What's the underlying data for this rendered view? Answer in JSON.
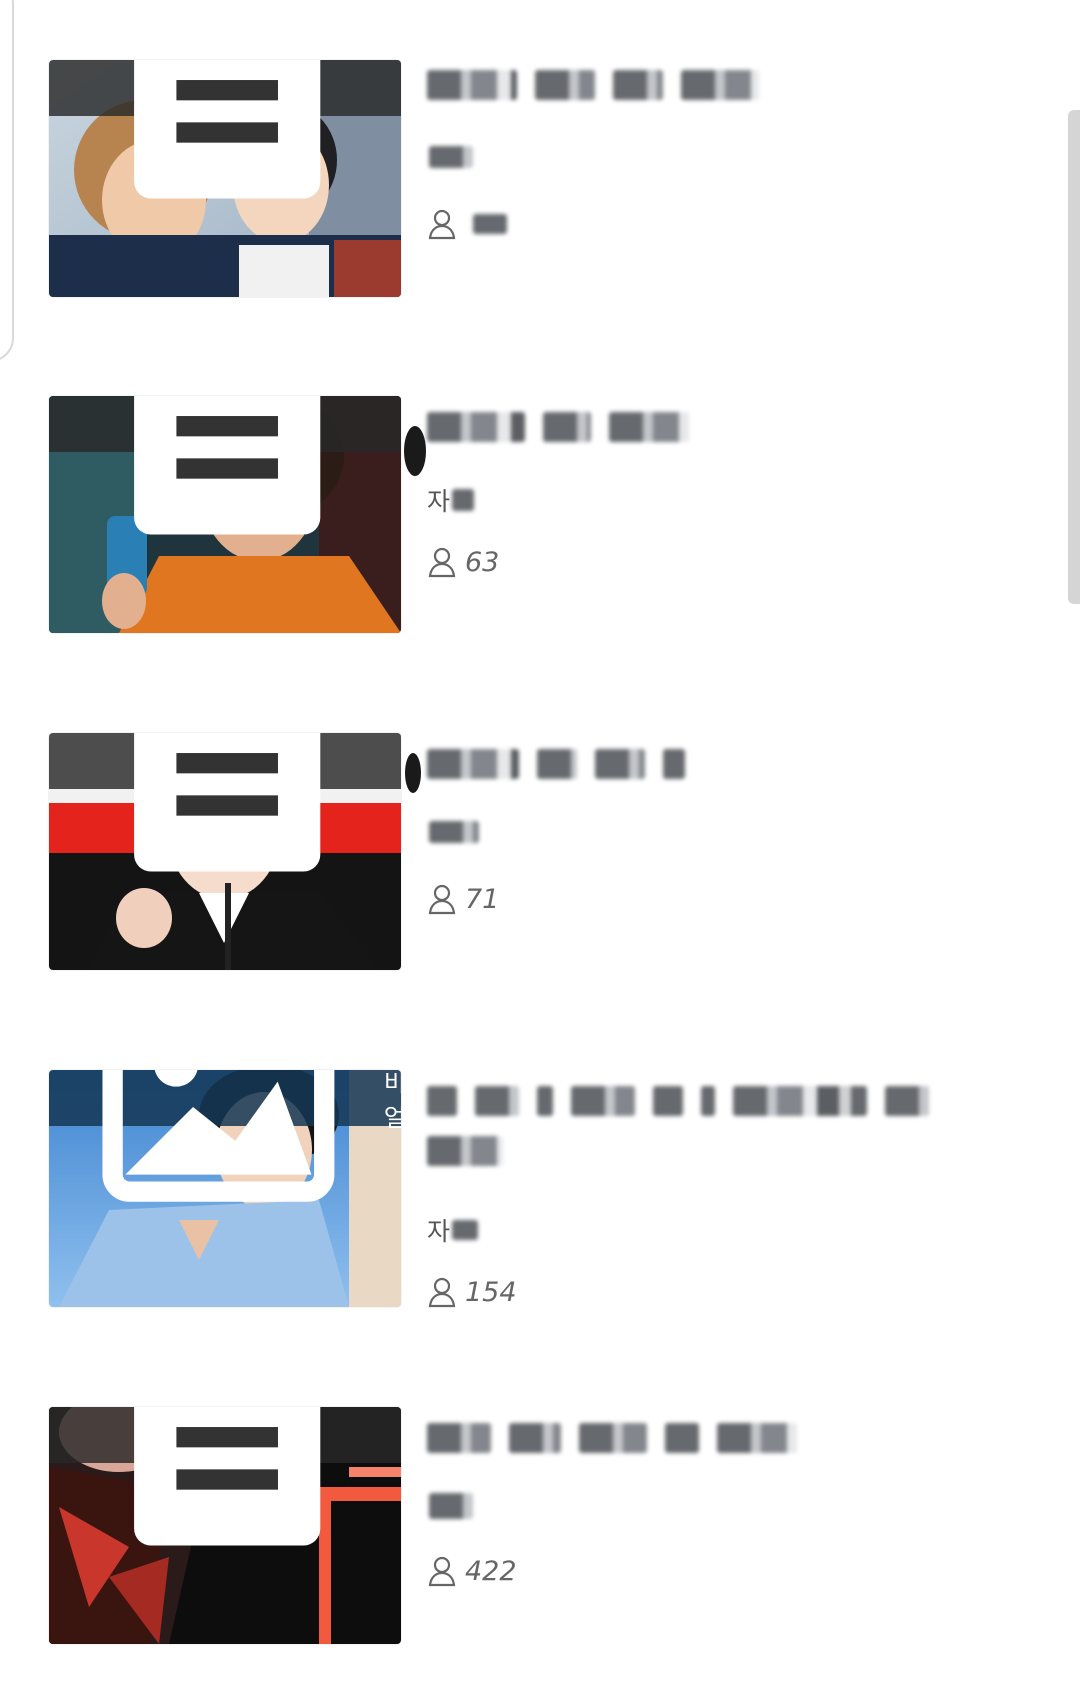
{
  "posts": [
    {
      "badge": {
        "icon": "document-icon",
        "label": "일반"
      },
      "category_text": "",
      "views": ""
    },
    {
      "badge": {
        "icon": "document-icon",
        "label": "일반"
      },
      "category_text": "자",
      "views": "63"
    },
    {
      "badge": {
        "icon": "document-icon",
        "label": "일반"
      },
      "category_text": "",
      "views": "71"
    },
    {
      "badge": {
        "icon": "image-icon",
        "label": "비주얼"
      },
      "category_text": "자",
      "views": "154"
    },
    {
      "badge": {
        "icon": "document-icon",
        "label": "일반"
      },
      "category_text": "",
      "views": "422"
    }
  ],
  "colors": {
    "badge_background": "#2a2a2a",
    "scrollbar": "#d5d5d5",
    "text_muted": "#666666"
  }
}
